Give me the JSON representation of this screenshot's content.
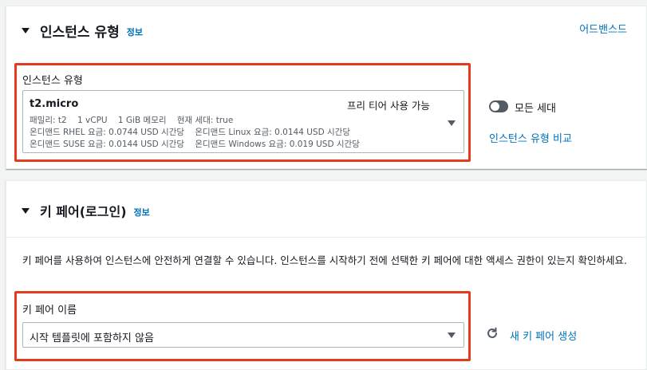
{
  "instance_section": {
    "title": "인스턴스 유형",
    "info_label": "정보",
    "advanced_link": "어드밴스드",
    "field_label": "인스턴스 유형",
    "selected": {
      "name": "t2.micro",
      "free_tier_badge": "프리 티어 사용 가능",
      "spec_line": "패밀리: t2    1 vCPU    1 GiB 메모리    현재 세대: true",
      "price_line_1": "온디맨드 RHEL 요금: 0.0744 USD 시간당    온디맨드 Linux 요금: 0.0144 USD 시간당",
      "price_line_2": "온디맨드 SUSE 요금: 0.0144 USD 시간당    온디맨드 Windows 요금: 0.019 USD 시간당"
    },
    "all_generations_toggle": {
      "label": "모든 세대",
      "on": false
    },
    "compare_link": "인스턴스 유형 비교"
  },
  "keypair_section": {
    "title": "키 페어(로그인)",
    "info_label": "정보",
    "description": "키 페어를 사용하여 인스턴스에 안전하게 연결할 수 있습니다. 인스턴스를 시작하기 전에 선택한 키 페어에 대한 액세스 권한이 있는지 확인하세요.",
    "field_label": "키 페어 이름",
    "select_value": "시작 템플릿에 포함하지 않음",
    "refresh_icon": "refresh-icon",
    "create_link": "새 키 페어 생성"
  },
  "colors": {
    "link": "#0073bb",
    "highlight": "#e33b1d",
    "text": "#16191f",
    "muted": "#545b64"
  }
}
